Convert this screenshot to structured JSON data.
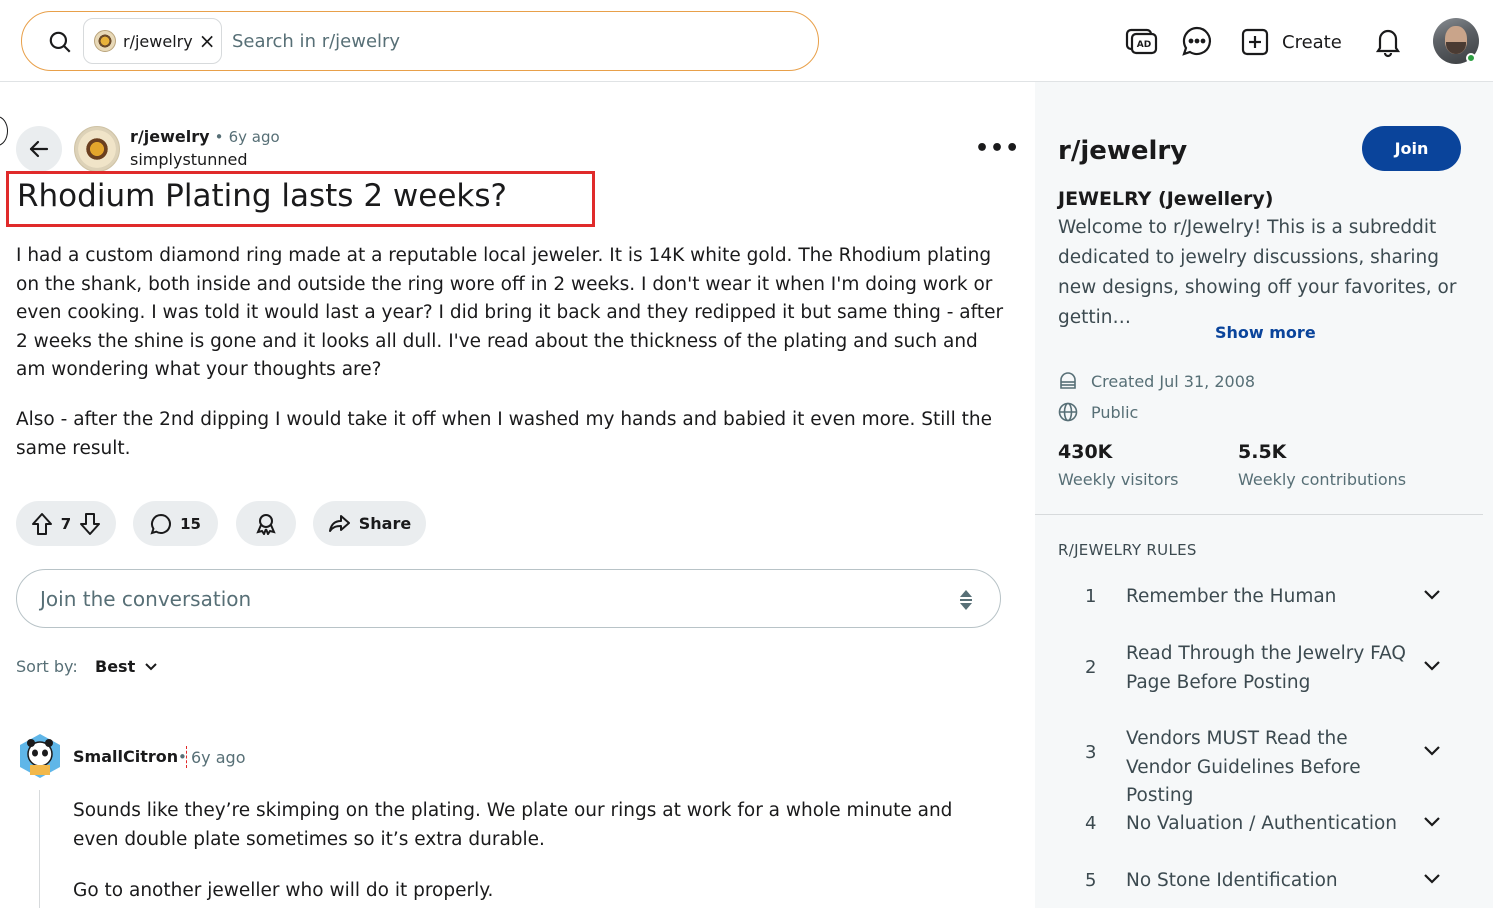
{
  "header": {
    "search_chip_label": "r/jewelry",
    "search_chip_remove": "×",
    "search_placeholder": "Search in r/jewelry",
    "create_label": "Create"
  },
  "post": {
    "subreddit": "r/jewelry",
    "separator": "•",
    "age": "6y ago",
    "author": "simplystunned",
    "more": "•••",
    "title": "Rhodium Plating lasts 2 weeks?",
    "paragraphs": [
      "I had a custom diamond ring made at a reputable local jeweler. It is 14K white gold. The Rhodium plating on the shank, both inside and outside the ring wore off in 2 weeks. I don't wear it when I'm doing work or even cooking. I was told it would last a year? I did bring it back and they redipped it but same thing - after 2 weeks the shine is gone and it looks all dull. I've read about the thickness of the plating and such and am wondering what your thoughts are?",
      "Also - after the 2nd dipping I would take it off when I washed my hands and babied it even more. Still the same result."
    ],
    "votes": "7",
    "comments": "15",
    "share_label": "Share"
  },
  "comment_box": {
    "placeholder": "Join the conversation"
  },
  "sort": {
    "label": "Sort by:",
    "value": "Best"
  },
  "comments": [
    {
      "user": "SmallCitron",
      "separator": "•",
      "age": "6y ago",
      "paragraphs": [
        "Sounds like they’re skimping on the plating. We plate our rings at work for a whole minute and even double plate sometimes so it’s extra durable.",
        "Go to another jeweller who will do it properly."
      ]
    }
  ],
  "sidebar": {
    "name": "r/jewelry",
    "join_label": "Join",
    "heading": "JEWELRY (Jewellery)",
    "description": "Welcome to r/Jewelry! This is a subreddit dedicated to jewelry discussions, sharing new designs, showing off your favorites, or gettin…",
    "show_more": "Show more",
    "created": "Created Jul 31, 2008",
    "visibility": "Public",
    "stats": [
      {
        "value": "430K",
        "label": "Weekly visitors"
      },
      {
        "value": "5.5K",
        "label": "Weekly contributions"
      }
    ],
    "rules_heading": "R/JEWELRY RULES",
    "rules": [
      {
        "num": "1",
        "text": "Remember the Human"
      },
      {
        "num": "2",
        "text": "Read Through the Jewelry FAQ Page Before Posting"
      },
      {
        "num": "3",
        "text": "Vendors MUST Read the Vendor Guidelines Before Posting"
      },
      {
        "num": "4",
        "text": "No Valuation / Authentication"
      },
      {
        "num": "5",
        "text": "No Stone Identification"
      }
    ]
  },
  "colors": {
    "accent": "#0a449b",
    "highlight_box": "#e02a2a",
    "search_border": "#e8a04a",
    "pill_bg": "#eaedef",
    "sidebar_bg": "#f6f8f9"
  },
  "icons": [
    "search-icon",
    "close-icon",
    "ad-icon",
    "chat-icon",
    "plus-icon",
    "bell-icon",
    "back-arrow-icon",
    "upvote-icon",
    "downvote-icon",
    "comment-icon",
    "award-icon",
    "share-icon",
    "sort-chevron-icon",
    "calendar-icon",
    "globe-icon",
    "chevron-down-icon"
  ]
}
